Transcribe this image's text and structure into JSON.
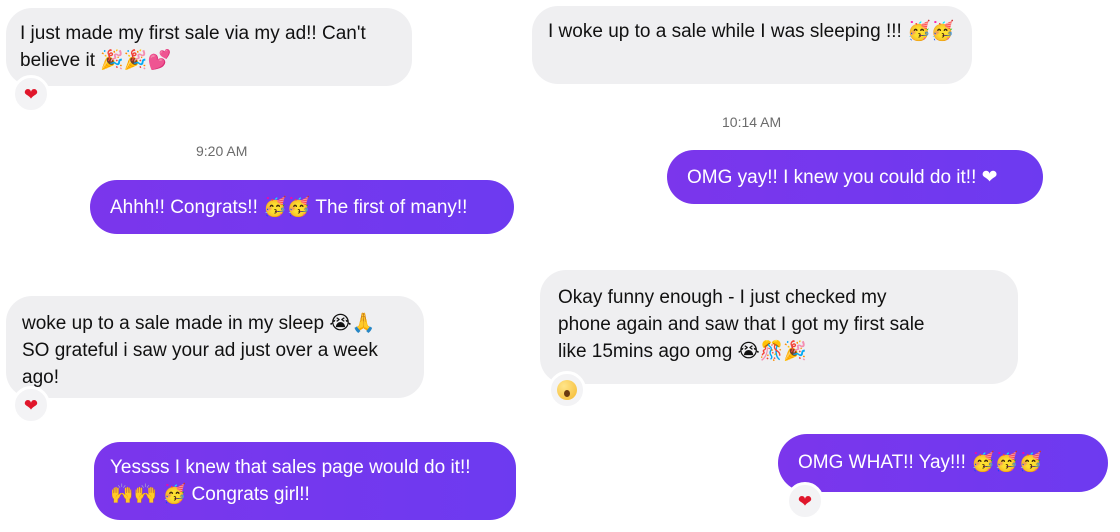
{
  "panels": {
    "top_left": {
      "incoming": {
        "text": "I just made my first sale via my ad!! Can't believe it 🎉🎉💕",
        "reaction": "❤"
      },
      "time": "9:20 AM",
      "outgoing": {
        "text": "Ahhh!! Congrats!! 🥳🥳 The first of many!!"
      }
    },
    "top_right": {
      "incoming": {
        "text": "I woke up to a sale while I was sleeping !!! 🥳🥳"
      },
      "time": "10:14 AM",
      "outgoing": {
        "text": "OMG yay!! I knew you could do it!! ❤"
      }
    },
    "bottom_left": {
      "incoming": {
        "text": "woke up to a sale made in my sleep 😭🙏\nSO grateful i saw your ad just over a week ago!",
        "reaction": "❤"
      },
      "outgoing": {
        "text": "Yessss I knew that sales page would do it!!\n🙌🙌 🥳 Congrats girl!!"
      }
    },
    "bottom_right": {
      "incoming": {
        "text": "Okay funny enough - I just checked my\nphone again and saw that I got my first sale\nlike 15mins ago omg 😭🎊🎉",
        "reaction": "wow-face"
      },
      "outgoing": {
        "text": "OMG WHAT!! Yay!!! 🥳🥳🥳",
        "reaction": "❤"
      }
    }
  },
  "colors": {
    "incoming_bubble": "#efeff1",
    "outgoing_bubble": "#7b36ec",
    "heart": "#e0162b"
  }
}
